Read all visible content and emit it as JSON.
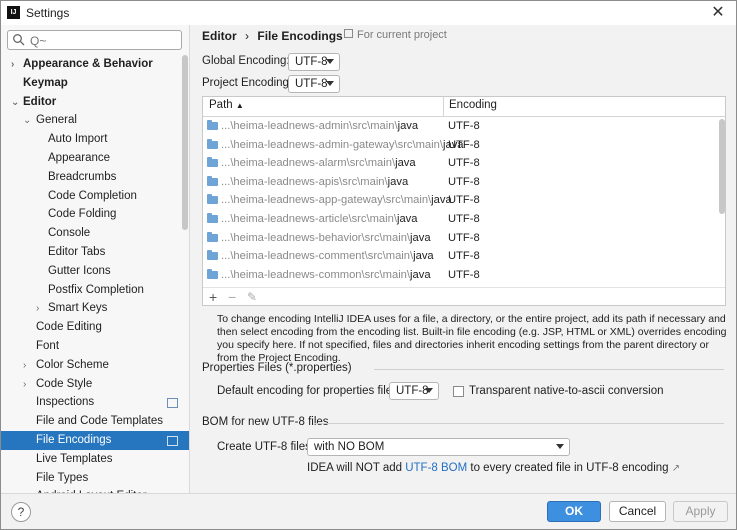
{
  "window": {
    "title": "Settings",
    "app_icon": "IJ"
  },
  "sidebar": {
    "search_placeholder": "Q~",
    "items": [
      {
        "label": "Appearance & Behavior",
        "level": 0,
        "arrow": "›",
        "bold": true
      },
      {
        "label": "Keymap",
        "level": 0,
        "arrow": "",
        "bold": true
      },
      {
        "label": "Editor",
        "level": 0,
        "arrow": "⌄",
        "bold": true
      },
      {
        "label": "General",
        "level": 1,
        "arrow": "⌄"
      },
      {
        "label": "Auto Import",
        "level": 2,
        "arrow": ""
      },
      {
        "label": "Appearance",
        "level": 2,
        "arrow": ""
      },
      {
        "label": "Breadcrumbs",
        "level": 2,
        "arrow": ""
      },
      {
        "label": "Code Completion",
        "level": 2,
        "arrow": ""
      },
      {
        "label": "Code Folding",
        "level": 2,
        "arrow": ""
      },
      {
        "label": "Console",
        "level": 2,
        "arrow": ""
      },
      {
        "label": "Editor Tabs",
        "level": 2,
        "arrow": ""
      },
      {
        "label": "Gutter Icons",
        "level": 2,
        "arrow": ""
      },
      {
        "label": "Postfix Completion",
        "level": 2,
        "arrow": ""
      },
      {
        "label": "Smart Keys",
        "level": 2,
        "arrow": "›"
      },
      {
        "label": "Code Editing",
        "level": 1,
        "arrow": ""
      },
      {
        "label": "Font",
        "level": 1,
        "arrow": ""
      },
      {
        "label": "Color Scheme",
        "level": 1,
        "arrow": "›"
      },
      {
        "label": "Code Style",
        "level": 1,
        "arrow": "›"
      },
      {
        "label": "Inspections",
        "level": 1,
        "arrow": "",
        "copy": true
      },
      {
        "label": "File and Code Templates",
        "level": 1,
        "arrow": ""
      },
      {
        "label": "File Encodings",
        "level": 1,
        "arrow": "",
        "copy": true,
        "selected": true
      },
      {
        "label": "Live Templates",
        "level": 1,
        "arrow": ""
      },
      {
        "label": "File Types",
        "level": 1,
        "arrow": ""
      },
      {
        "label": "Android Layout Editor",
        "level": 1,
        "arrow": ""
      }
    ]
  },
  "header": {
    "crumb_parent": "Editor",
    "crumb_sep": "›",
    "crumb_current": "File Encodings",
    "scope": "For current project"
  },
  "global_encoding": {
    "label": "Global Encoding:",
    "value": "UTF-8"
  },
  "project_encoding": {
    "label": "Project Encoding:",
    "value": "UTF-8"
  },
  "table": {
    "col_path": "Path",
    "sort_arrow": "▲",
    "col_encoding": "Encoding",
    "rows": [
      {
        "prefix": "...\\heima-leadnews-admin\\src\\main\\",
        "leaf": "java",
        "encoding": "UTF-8"
      },
      {
        "prefix": "...\\heima-leadnews-admin-gateway\\src\\main\\",
        "leaf": "java",
        "encoding": "UTF-8"
      },
      {
        "prefix": "...\\heima-leadnews-alarm\\src\\main\\",
        "leaf": "java",
        "encoding": "UTF-8"
      },
      {
        "prefix": "...\\heima-leadnews-apis\\src\\main\\",
        "leaf": "java",
        "encoding": "UTF-8"
      },
      {
        "prefix": "...\\heima-leadnews-app-gateway\\src\\main\\",
        "leaf": "java",
        "encoding": "UTF-8"
      },
      {
        "prefix": "...\\heima-leadnews-article\\src\\main\\",
        "leaf": "java",
        "encoding": "UTF-8"
      },
      {
        "prefix": "...\\heima-leadnews-behavior\\src\\main\\",
        "leaf": "java",
        "encoding": "UTF-8"
      },
      {
        "prefix": "...\\heima-leadnews-comment\\src\\main\\",
        "leaf": "java",
        "encoding": "UTF-8"
      },
      {
        "prefix": "...\\heima-leadnews-common\\src\\main\\",
        "leaf": "java",
        "encoding": "UTF-8"
      }
    ],
    "add": "+",
    "remove": "−",
    "edit": "✎"
  },
  "description": "To change encoding IntelliJ IDEA uses for a file, a directory, or the entire project, add its path if necessary and then select encoding from the encoding list. Built-in file encoding (e.g. JSP, HTML or XML) overrides encoding you specify here. If not specified, files and directories inherit encoding settings from the parent directory or from the Project Encoding.",
  "properties": {
    "section": "Properties Files (*.properties)",
    "default_label": "Default encoding for properties files:",
    "default_value": "UTF-8",
    "transparent_label": "Transparent native-to-ascii conversion"
  },
  "bom": {
    "section": "BOM for new UTF-8 files",
    "create_label": "Create UTF-8 files:",
    "create_value": "with NO BOM",
    "note_before": "IDEA will NOT add ",
    "note_link": "UTF-8 BOM",
    "note_after": " to every created file in UTF-8 encoding",
    "note_ext": "↗"
  },
  "footer": {
    "help": "?",
    "ok": "OK",
    "cancel": "Cancel",
    "apply": "Apply"
  }
}
